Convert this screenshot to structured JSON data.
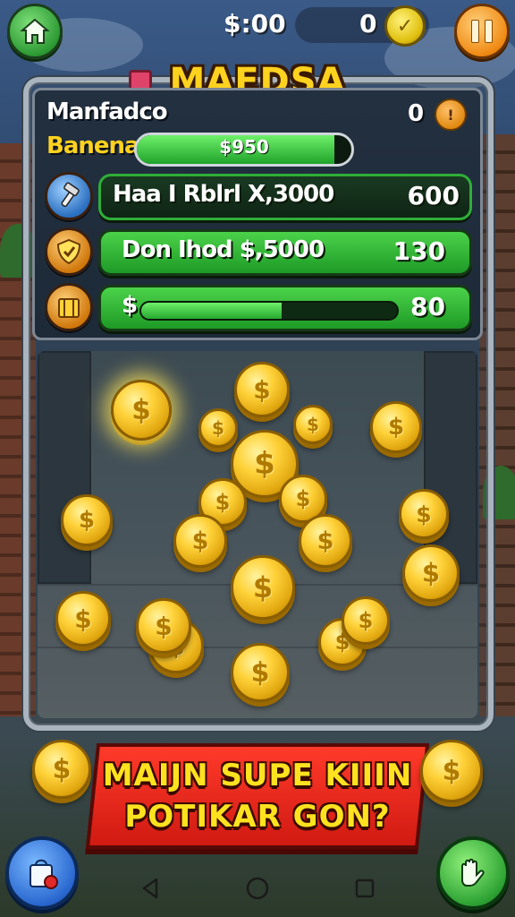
{
  "hud": {
    "money": "$:00",
    "coins": "0",
    "coin_glyph": "✓"
  },
  "title": "MAEDSA",
  "stats": {
    "line1_label": "Manfadco",
    "line1_value": "0",
    "line1_pin_glyph": "!",
    "bank_label": "Banenan",
    "bank_text": "$950",
    "bank_progress": 0.92
  },
  "rows": [
    {
      "text": "Haa I Rblrl X,3000",
      "value": "600",
      "icon": "hammer-icon"
    },
    {
      "text": "Don Ihod $,5000",
      "value": "130",
      "icon": "shield-icon"
    },
    {
      "text": "$",
      "value": "80",
      "icon": "crate-icon",
      "progress": 0.55
    }
  ],
  "coin_symbol": "$",
  "banner": {
    "line1": "MAIJN  SUPE KIIIN",
    "line2": "POTIKAR GON?"
  },
  "colors": {
    "accent_yellow": "#ffd21f",
    "button_green": "#2d9a34",
    "button_orange": "#f08a14",
    "banner_red": "#d01a12"
  }
}
